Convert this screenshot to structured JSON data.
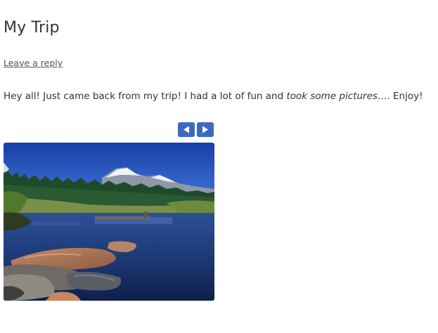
{
  "post": {
    "title": "My Trip",
    "reply_link": "Leave a reply",
    "intro_before": "Hey all! Just came back from my trip! I had a lot of fun and ",
    "intro_italic": "took some pictures",
    "intro_after": "…. Enjoy!"
  },
  "slider": {
    "prev_icon": "triangle-left-icon",
    "next_icon": "triangle-right-icon",
    "accent_color": "#3d6ac1"
  }
}
